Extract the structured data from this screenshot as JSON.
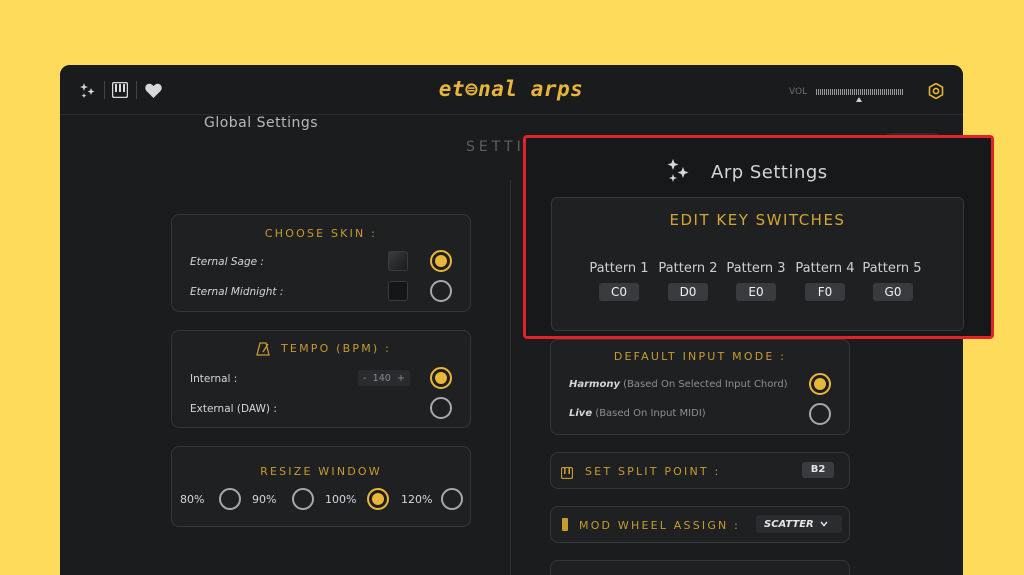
{
  "topbar": {
    "logo": "et⊜nal arps",
    "vol_label": "VOL"
  },
  "settings": {
    "title": "SETTI"
  },
  "global": {
    "title": "Global Settings",
    "skin": {
      "heading": "CHOOSE SKIN :",
      "options": [
        {
          "label": "Eternal Sage :",
          "selected": true,
          "swatch_color": "#2b2d2e"
        },
        {
          "label": "Eternal Midnight :",
          "selected": false,
          "swatch_color": "#151617"
        }
      ]
    },
    "tempo": {
      "heading": "TEMPO (BPM) :",
      "internal_label": "Internal :",
      "internal_value": "140",
      "stepper_minus": "-",
      "stepper_plus": "+",
      "external_label": "External (DAW) :",
      "internal_selected": true
    },
    "resize": {
      "heading": "RESIZE WINDOW",
      "options": [
        {
          "label": "80%",
          "selected": false
        },
        {
          "label": "90%",
          "selected": false
        },
        {
          "label": "100%",
          "selected": true
        },
        {
          "label": "120%",
          "selected": false
        }
      ]
    }
  },
  "arp": {
    "title": "Arp Settings",
    "key_switches": {
      "heading": "EDIT KEY SWITCHES",
      "patterns": [
        {
          "label": "Pattern 1",
          "note": "C0"
        },
        {
          "label": "Pattern 2",
          "note": "D0"
        },
        {
          "label": "Pattern 3",
          "note": "E0"
        },
        {
          "label": "Pattern 4",
          "note": "F0"
        },
        {
          "label": "Pattern 5",
          "note": "G0"
        }
      ]
    },
    "input_mode": {
      "heading": "DEFAULT INPUT MODE :",
      "harmony_bold": "Harmony",
      "harmony_rest": "(Based On Selected Input Chord)",
      "live_bold": "Live",
      "live_rest": "(Based On Input MIDI)",
      "harmony_selected": true
    },
    "split": {
      "label": "SET SPLIT POINT :",
      "value": "B2"
    },
    "mod_wheel": {
      "label": "MOD WHEEL ASSIGN :",
      "value": "SCATTER"
    }
  },
  "colors": {
    "accent": "#e8b63a",
    "highlight": "#e0232a",
    "background": "#FFDB5C"
  }
}
